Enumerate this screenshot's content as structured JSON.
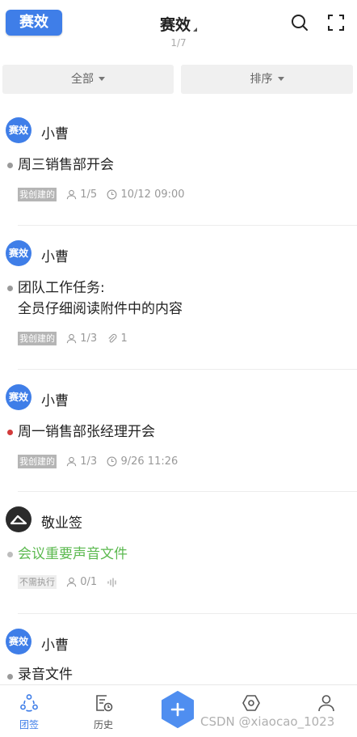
{
  "header": {
    "logo_text": "赛效",
    "title": "赛效",
    "pager": "1/7",
    "search_icon": "search-icon",
    "fullscreen_icon": "fullscreen-icon"
  },
  "filters": {
    "all_label": "全部",
    "sort_label": "排序"
  },
  "items": [
    {
      "user": "小曹",
      "avatar_text": "赛效",
      "task_line1": "周三销售部开会",
      "task_line2": "",
      "tag": "我创建的",
      "members": "1/5",
      "extra": "10/12 09:00",
      "extra_icon": "clock-icon",
      "dot_color": "#9a9a9a"
    },
    {
      "user": "小曹",
      "avatar_text": "赛效",
      "task_line1": "团队工作任务:",
      "task_line2": "全员仔细阅读附件中的内容",
      "tag": "我创建的",
      "members": "1/3",
      "extra": "1",
      "extra_icon": "paperclip-icon",
      "dot_color": "#9a9a9a"
    },
    {
      "user": "小曹",
      "avatar_text": "赛效",
      "task_line1": "周一销售部张经理开会",
      "task_line2": "",
      "tag": "我创建的",
      "members": "1/3",
      "extra": "9/26 11:26",
      "extra_icon": "clock-icon",
      "dot_color": "#d23b3b"
    },
    {
      "user": "敬业签",
      "avatar_text": "",
      "task_line1": "会议重要声音文件",
      "task_line2": "",
      "tag": "不需执行",
      "members": "0/1",
      "extra": "",
      "extra_icon": "audio-wave-icon",
      "dot_color": "#bdbdbd",
      "task_color": "#5bb94f"
    },
    {
      "user": "小曹",
      "avatar_text": "赛效",
      "task_line1": "录音文件",
      "task_line2": ""
    }
  ],
  "tabbar": {
    "tabs": [
      {
        "label": "团签",
        "icon": "team-icon",
        "active": true
      },
      {
        "label": "历史",
        "icon": "history-icon",
        "active": false
      },
      {
        "label": "",
        "icon": "plus-icon",
        "active": false
      },
      {
        "label": "",
        "icon": "settings-icon",
        "active": false
      },
      {
        "label": "",
        "icon": "user-icon",
        "active": false
      }
    ]
  },
  "watermark": "CSDN @xiaocao_1023",
  "colors": {
    "accent": "#3f7ee8",
    "tag_gray": "#b5b5b5",
    "green_text": "#5bb94f",
    "red_dot": "#d23b3b"
  }
}
